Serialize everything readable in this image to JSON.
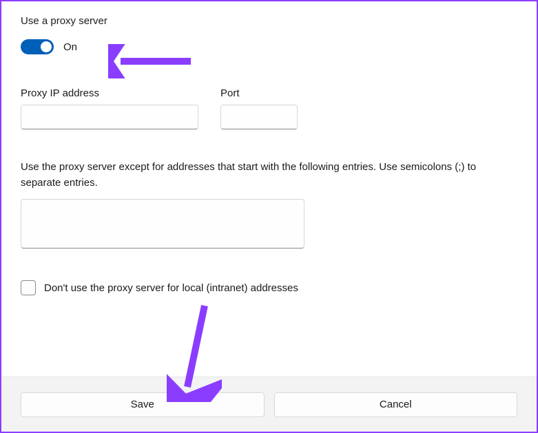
{
  "title": "Use a proxy server",
  "toggle": {
    "state_label": "On",
    "enabled": true
  },
  "proxy_ip": {
    "label": "Proxy IP address",
    "value": ""
  },
  "port": {
    "label": "Port",
    "value": ""
  },
  "exceptions": {
    "label": "Use the proxy server except for addresses that start with the following entries. Use semicolons (;) to separate entries.",
    "value": ""
  },
  "local_bypass": {
    "label": "Don't use the proxy server for local (intranet) addresses",
    "checked": false
  },
  "buttons": {
    "save": "Save",
    "cancel": "Cancel"
  }
}
